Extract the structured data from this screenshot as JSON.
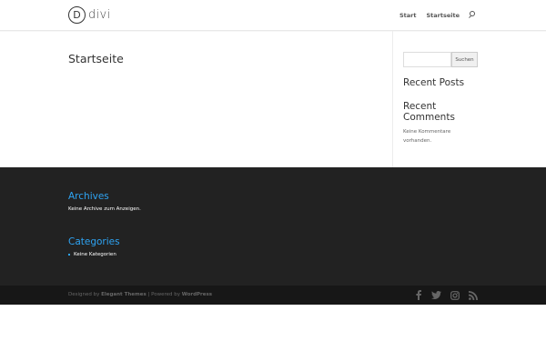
{
  "header": {
    "logo_letter": "D",
    "logo_text": "divi",
    "nav": [
      {
        "label": "Start"
      },
      {
        "label": "Startseite"
      }
    ],
    "search_icon": "search-icon"
  },
  "main": {
    "page_title": "Startseite"
  },
  "sidebar": {
    "search_placeholder": "",
    "search_button": "Suchen",
    "recent_posts_title": "Recent Posts",
    "recent_comments_title": "Recent Comments",
    "no_comments_text": "Keine Kommentare vorhanden."
  },
  "footer": {
    "archives_title": "Archives",
    "archives_empty": "Keine Archive zum Anzeigen.",
    "categories_title": "Categories",
    "categories_item": "Keine Kategorien",
    "credits": {
      "designed_by": "Designed by",
      "elegant_themes": "Elegant Themes",
      "separator": "| Powered by",
      "wordpress": "WordPress"
    },
    "social_icons": [
      "facebook-icon",
      "twitter-icon",
      "instagram-icon",
      "rss-icon"
    ]
  },
  "colors": {
    "accent": "#2ea3f2",
    "footer_bg": "#222222",
    "bottom_bar_bg": "#171717"
  }
}
